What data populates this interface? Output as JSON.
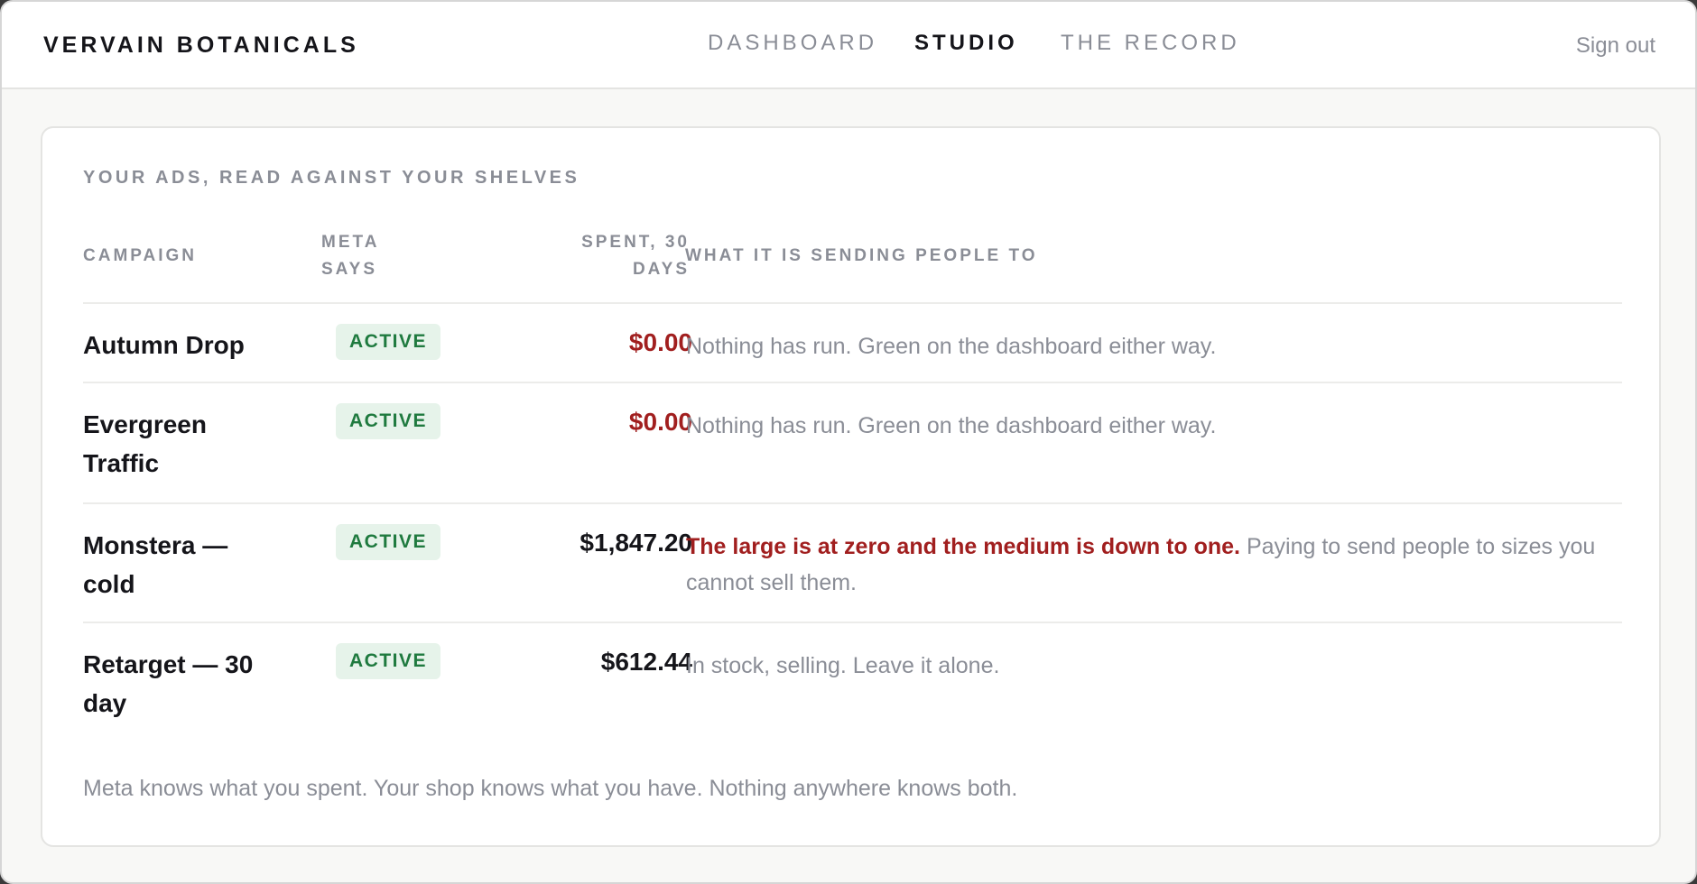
{
  "header": {
    "brand": "VERVAIN BOTANICALS",
    "nav": [
      {
        "label": "DASHBOARD",
        "active": false
      },
      {
        "label": "STUDIO",
        "active": true
      },
      {
        "label": "THE RECORD",
        "active": false
      }
    ],
    "sign_out": "Sign out"
  },
  "panel": {
    "title": "YOUR ADS, READ AGAINST YOUR SHELVES",
    "columns": {
      "campaign": "CAMPAIGN",
      "meta_line1": "META",
      "meta_line2": "SAYS",
      "spent_line1": "SPENT, 30",
      "spent_line2": "DAYS",
      "destination": "WHAT IT IS SENDING PEOPLE TO"
    },
    "rows": [
      {
        "campaign": "Autumn Drop",
        "status": "ACTIVE",
        "spent": "$0.00",
        "note_alert": "",
        "note": "Nothing has run. Green on the dashboard either way."
      },
      {
        "campaign": "Evergreen Traffic",
        "status": "ACTIVE",
        "spent": "$0.00",
        "note_alert": "",
        "note": "Nothing has run. Green on the dashboard either way."
      },
      {
        "campaign": "Monstera — cold",
        "status": "ACTIVE",
        "spent": "$1,847.20",
        "note_alert": "The large is at zero and the medium is down to one.",
        "note": "Paying to send people to sizes you cannot sell them."
      },
      {
        "campaign": "Retarget — 30 day",
        "status": "ACTIVE",
        "spent": "$612.44",
        "note_alert": "",
        "note": "In stock, selling. Leave it alone."
      }
    ],
    "footnote": "Meta knows what you spent. Your shop knows what you have. Nothing anywhere knows both."
  },
  "colors": {
    "alert": "#a11f1f",
    "badge_bg": "#e6f3ea",
    "badge_text": "#1f7a3f",
    "muted": "#8a8d96",
    "ink": "#15151a"
  }
}
